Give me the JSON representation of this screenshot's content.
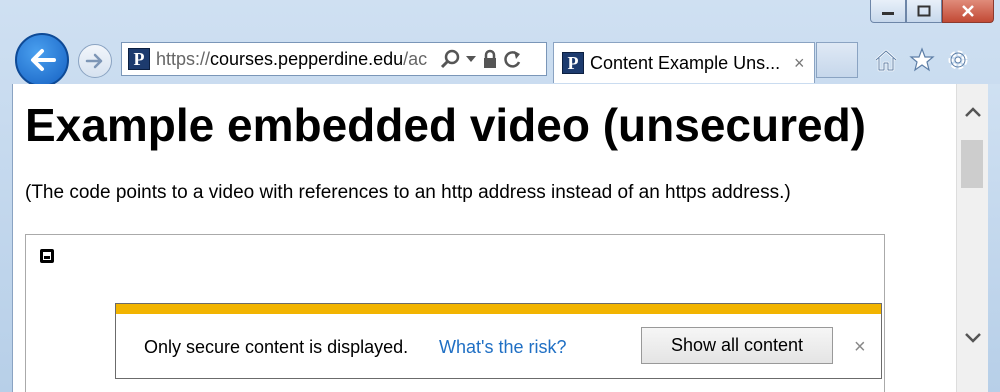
{
  "browser": {
    "url_scheme": "https://",
    "url_host": "courses.pepperdine.edu",
    "url_rest": "/ac",
    "favicon_letter": "P",
    "tab_title": "Content Example Uns...",
    "tab_close": "×"
  },
  "page": {
    "heading": "Example embedded video (unsecured)",
    "description": "(The code points to a video with references to an http address instead of an https address.)"
  },
  "notification": {
    "message": "Only secure content is displayed.",
    "risk_link": "What's the risk?",
    "show_button": "Show all content",
    "close": "×",
    "bar_color": "#f2b400"
  },
  "icons": [
    "back-arrow-icon",
    "forward-arrow-icon",
    "search-icon",
    "dropdown-icon",
    "lock-icon",
    "refresh-icon",
    "home-icon",
    "favorites-star-icon",
    "settings-gear-icon",
    "plugin-icon"
  ]
}
